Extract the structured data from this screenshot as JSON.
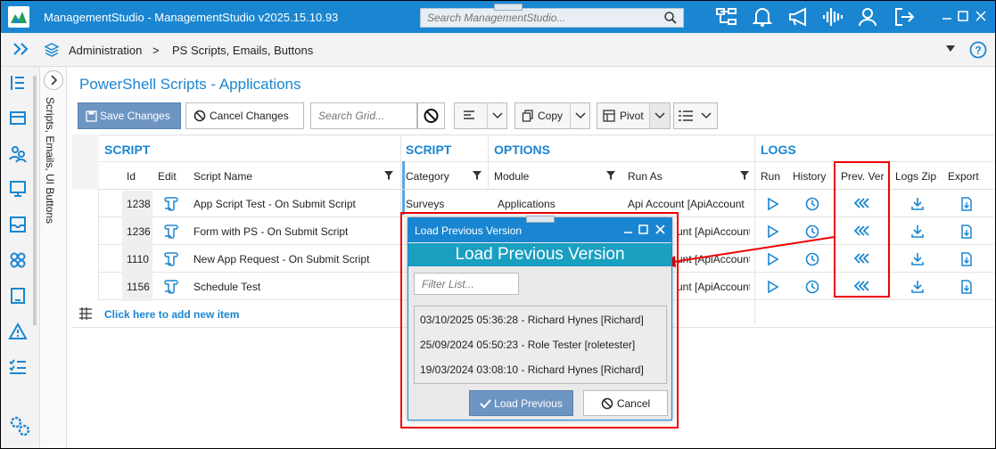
{
  "window": {
    "title": "ManagementStudio - ManagementStudio v2025.15.10.93",
    "search_placeholder": "Search ManagementStudio..."
  },
  "breadcrumb": {
    "root": "Administration",
    "separator": ">",
    "current": "PS Scripts, Emails, Buttons"
  },
  "side_tab": {
    "label": "Scripts, Emails, UI Buttons"
  },
  "page": {
    "title": "PowerShell Scripts - Applications"
  },
  "toolbar": {
    "save_label": "Save Changes",
    "cancel_label": "Cancel Changes",
    "search_placeholder": "Search Grid...",
    "copy_label": "Copy",
    "pivot_label": "Pivot"
  },
  "grid": {
    "groups": [
      "SCRIPT",
      "SCRIPT",
      "OPTIONS",
      "LOGS"
    ],
    "columns": {
      "id": "Id",
      "edit": "Edit",
      "name": "Script Name",
      "category": "Category",
      "module": "Module",
      "run_as": "Run As",
      "run": "Run",
      "history": "History",
      "prev_ver": "Prev. Ver",
      "logs_zip": "Logs Zip",
      "export": "Export"
    },
    "rows": [
      {
        "id": "1238",
        "name": "App Script Test - On Submit Script",
        "category": "Surveys",
        "module": "Applications",
        "run_as": "Api Account [ApiAccount"
      },
      {
        "id": "1236",
        "name": "Form with PS - On Submit Script",
        "category": "",
        "module": "",
        "run_as": "unt [ApiAccount"
      },
      {
        "id": "1110",
        "name": "New App Request - On Submit Script",
        "category": "",
        "module": "",
        "run_as": "unt [ApiAccount"
      },
      {
        "id": "1156",
        "name": "Schedule Test",
        "category": "",
        "module": "",
        "run_as": "unt [ApiAccount"
      }
    ],
    "add_row_label": "Click here to add new item"
  },
  "dialog": {
    "title": "Load Previous Version",
    "heading": "Load Previous Version",
    "filter_placeholder": "Filter List...",
    "items": [
      "03/10/2025 05:36:28 - Richard Hynes [Richard]",
      "25/09/2024 05:50:23 - Role Tester [roletester]",
      "19/03/2024 03:08:10 - Richard Hynes [Richard]"
    ],
    "load_label": "Load Previous",
    "cancel_label": "Cancel"
  },
  "colors": {
    "brand": "#1a86d1",
    "band": "#1a9fc0",
    "button_primary": "#6e95c2",
    "highlight": "#e00000"
  },
  "icons": {
    "titlebar": [
      "hierarchy-icon",
      "bell-icon",
      "megaphone-icon",
      "waveform-icon",
      "user-icon",
      "logout-icon"
    ],
    "rail": [
      "list-icon",
      "cards-icon",
      "people-icon",
      "device-icon",
      "inbox-icon",
      "apps-icon",
      "tablet-icon",
      "warning-icon",
      "checklist-icon",
      "settings-icon"
    ]
  }
}
